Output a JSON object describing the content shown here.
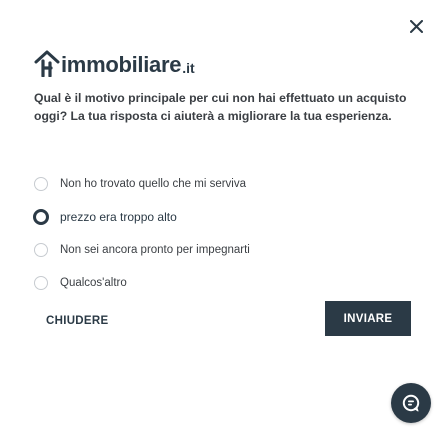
{
  "brand": {
    "logo_text": "immobiliare",
    "logo_tld": ".it",
    "color": "#2b3a46"
  },
  "survey": {
    "question": "Qual è il motivo principale per cui non hai effettuato un acquisto oggi? La tua risposta ci aiuterà a migliorare la tua esperienza.",
    "options": [
      {
        "label": "Non ho trovato quello che mi serviva",
        "checked": false
      },
      {
        "label": "prezzo era troppo alto",
        "checked": true
      },
      {
        "label": "Non sei ancora pronto per impegnarti",
        "checked": false
      },
      {
        "label": "Qualcos'altro",
        "checked": false
      }
    ]
  },
  "actions": {
    "close_label": "CHIUDERE",
    "submit_label": "INVIARE"
  },
  "icons": {
    "close": "close-icon",
    "chat": "chat-icon"
  }
}
